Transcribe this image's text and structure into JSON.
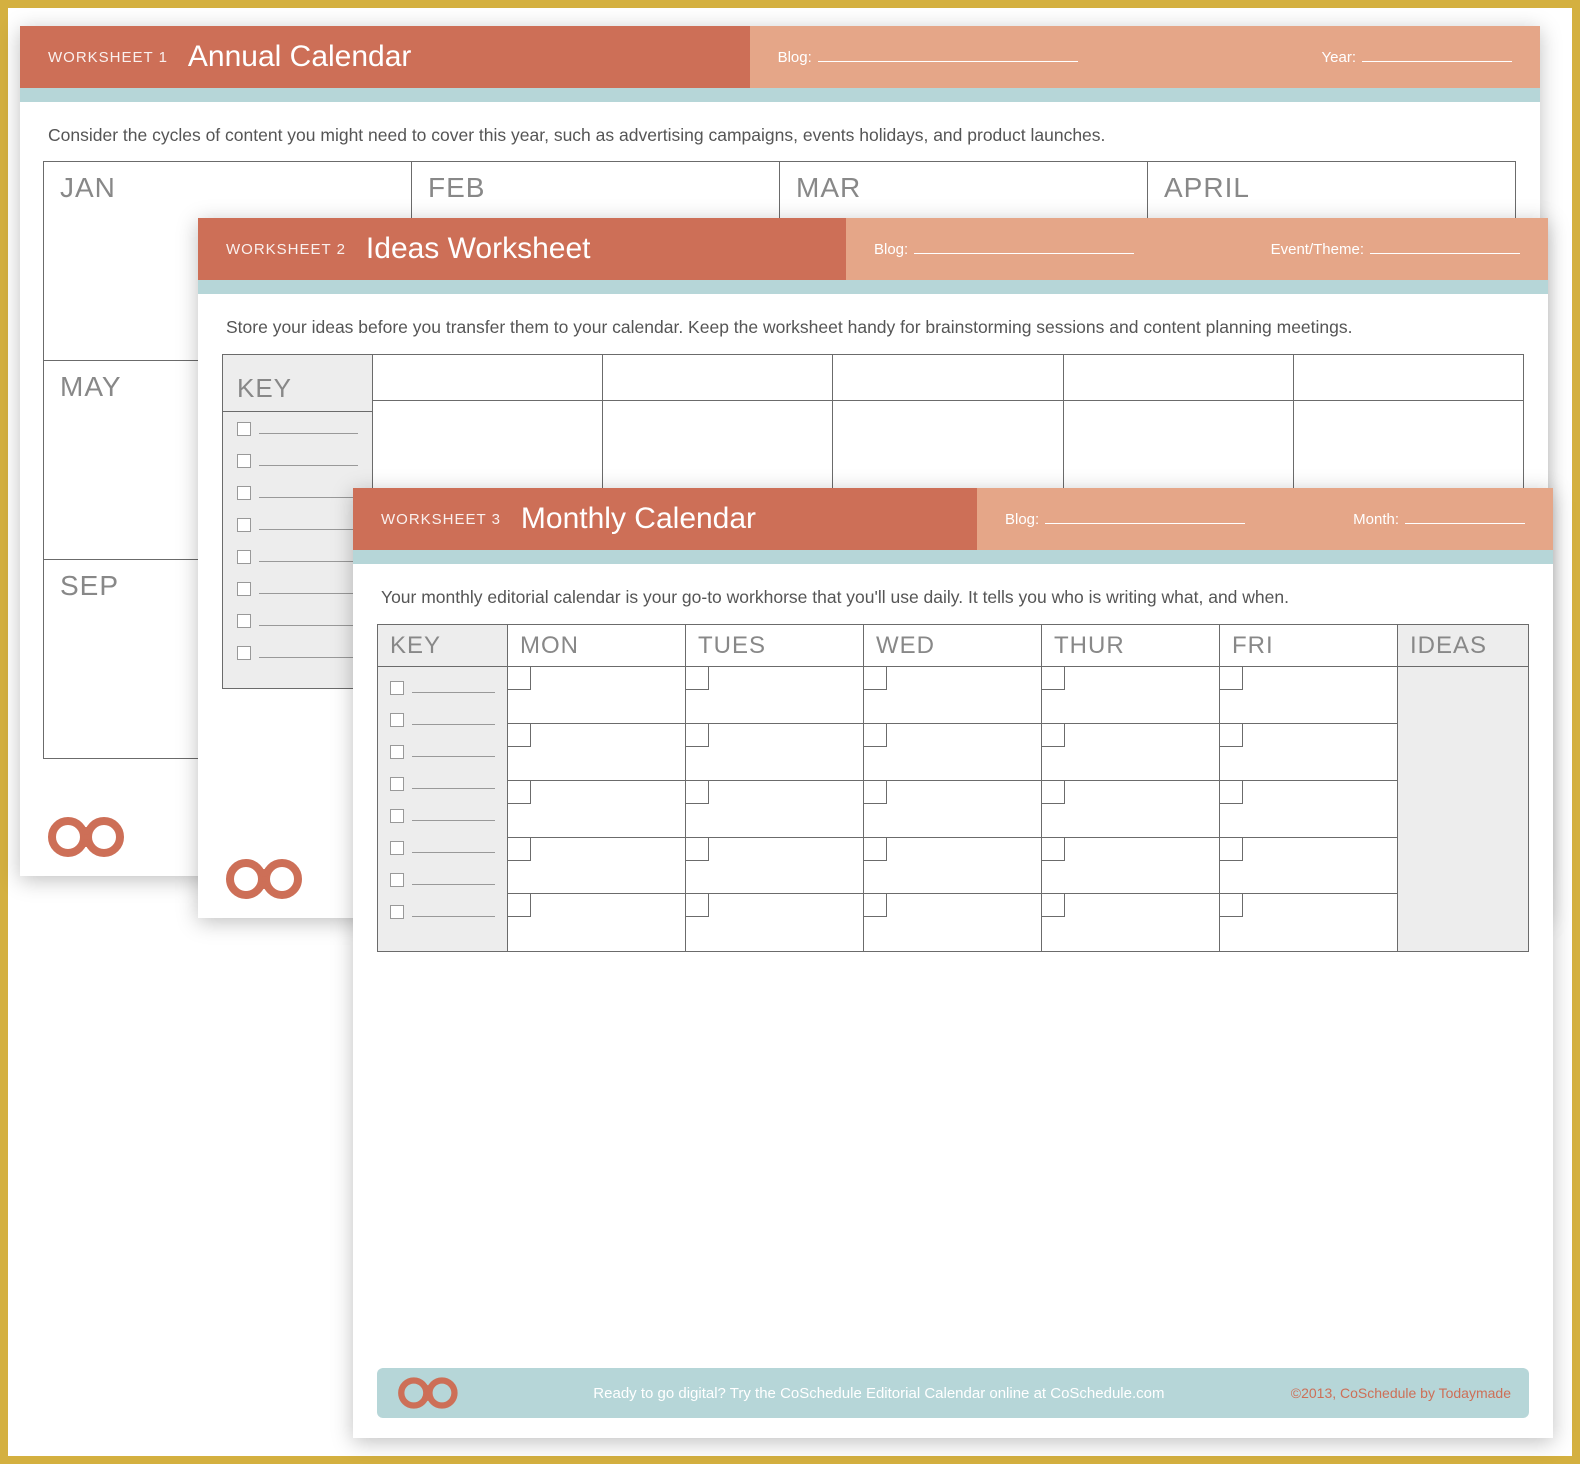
{
  "worksheets": [
    {
      "num": "WORKSHEET 1",
      "title": "Annual Calendar",
      "field1_label": "Blog:",
      "field2_label": "Year:",
      "instruct": "Consider the cycles of content you might need to cover this year, such as advertising campaigns, events holidays, and product launches.",
      "months": [
        "JAN",
        "FEB",
        "MAR",
        "APRIL",
        "MAY",
        "",
        "",
        "",
        "SEP",
        "",
        "",
        ""
      ]
    },
    {
      "num": "WORKSHEET 2",
      "title": "Ideas Worksheet",
      "field1_label": "Blog:",
      "field2_label": "Event/Theme:",
      "instruct": "Store your ideas before you transfer them to your calendar. Keep the worksheet handy for brainstorming sessions and content planning meetings.",
      "key_label": "KEY"
    },
    {
      "num": "WORKSHEET 3",
      "title": "Monthly Calendar",
      "field1_label": "Blog:",
      "field2_label": "Month:",
      "instruct": "Your monthly editorial calendar is your go-to workhorse that you'll use daily. It tells you who is writing what, and when.",
      "key_label": "KEY",
      "days": [
        "MON",
        "TUES",
        "WED",
        "THUR",
        "FRI"
      ],
      "ideas_label": "IDEAS",
      "footer_text": "Ready to go digital? Try the CoSchedule Editorial Calendar online at CoSchedule.com",
      "footer_copy": "©2013, CoSchedule by Todaymade"
    }
  ]
}
